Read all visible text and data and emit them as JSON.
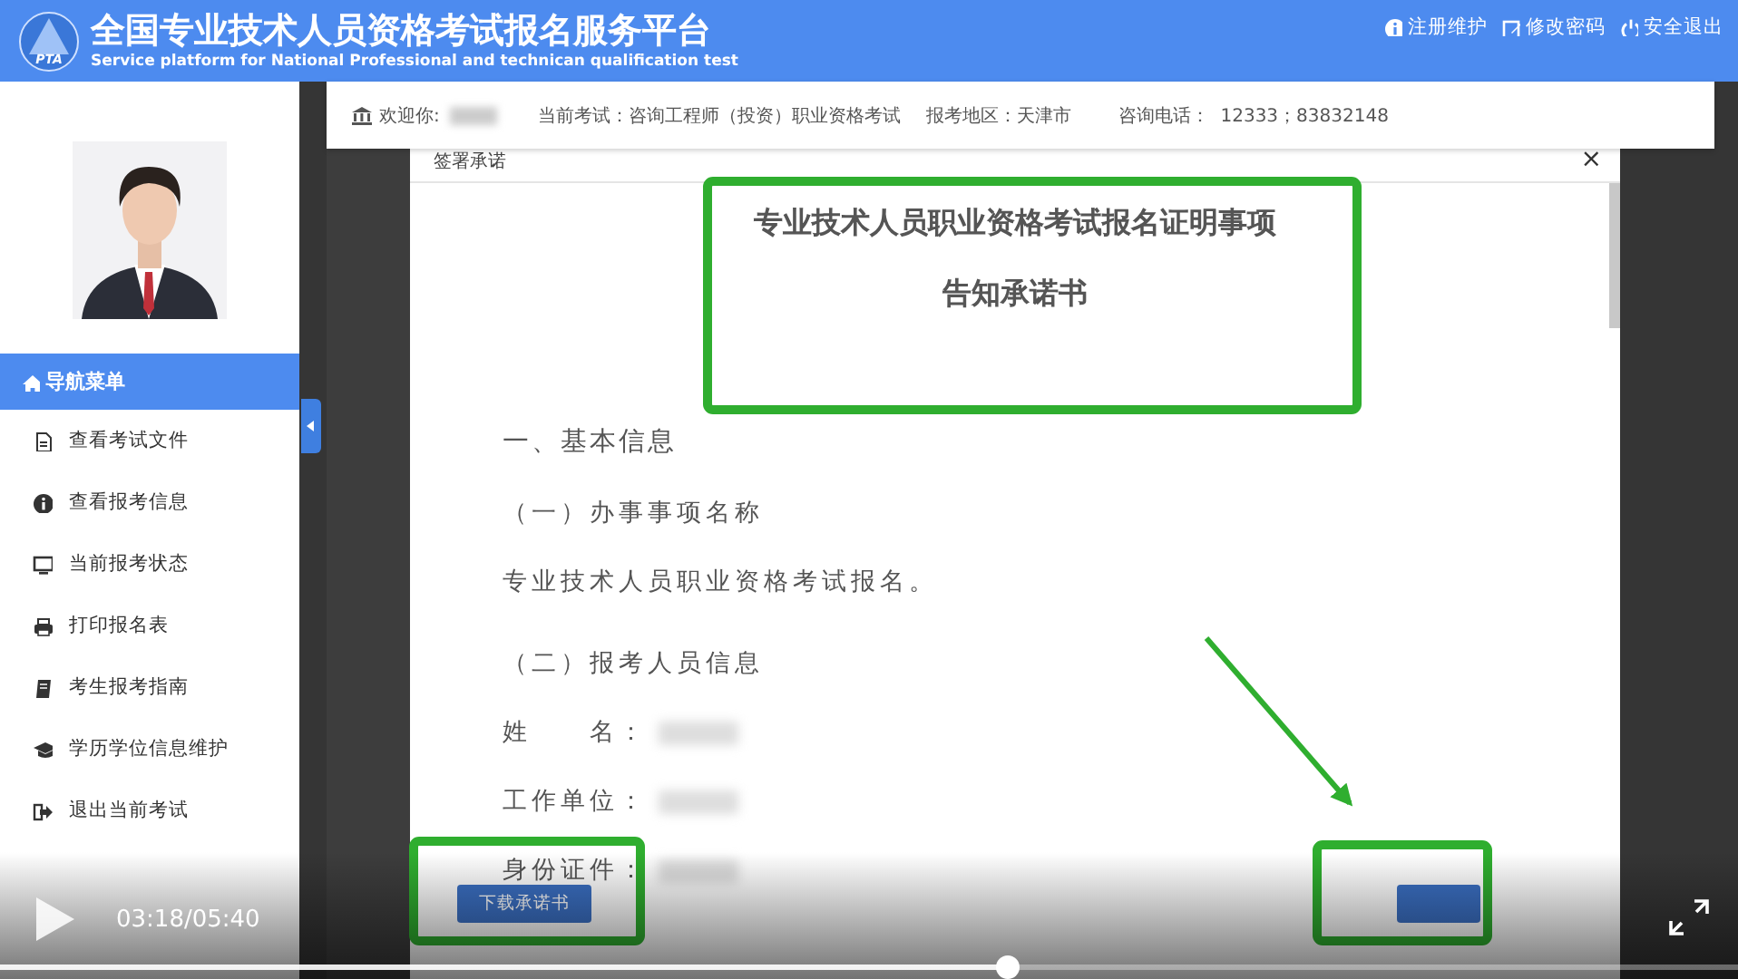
{
  "header": {
    "logo_text": "PTA",
    "title": "全国专业技术人员资格考试报名服务平台",
    "subtitle": "Service platform for National Professional and technican qualification test",
    "links": [
      {
        "label": "注册维护"
      },
      {
        "label": "修改密码"
      },
      {
        "label": "安全退出"
      }
    ]
  },
  "info_bar": {
    "welcome": "欢迎你:",
    "exam": "当前考试：咨询工程师（投资）职业资格考试",
    "region": "报考地区：天津市",
    "phone": "咨询电话：  12333；83832148"
  },
  "sidebar": {
    "menu_title": "导航菜单",
    "items": [
      {
        "label": "查看考试文件"
      },
      {
        "label": "查看报考信息"
      },
      {
        "label": "当前报考状态"
      },
      {
        "label": "打印报名表"
      },
      {
        "label": "考生报考指南"
      },
      {
        "label": "学历学位信息维护"
      },
      {
        "label": "退出当前考试"
      }
    ]
  },
  "modal": {
    "title": "签署承诺",
    "close": "×",
    "doc_title": [
      "专业技术人员职业资格考试报名证明事项",
      "告知承诺书"
    ],
    "paragraphs": [
      {
        "kind": "heading",
        "text": "一、基本信息"
      },
      {
        "kind": "subheading",
        "text": "（一）办事事项名称"
      },
      {
        "kind": "text",
        "text": "专业技术人员职业资格考试报名。"
      },
      {
        "kind": "subheading",
        "text": "（二）报考人员信息"
      },
      {
        "kind": "field",
        "text": "姓　　名："
      },
      {
        "kind": "field",
        "text": "工作单位："
      },
      {
        "kind": "field",
        "text": "身份证件："
      }
    ],
    "buttons": [
      {
        "kind": "labeled",
        "label": "下载承诺书"
      },
      {
        "kind": "covered"
      }
    ]
  },
  "annotations": [
    {
      "kind": "title-box"
    },
    {
      "kind": "download-box"
    },
    {
      "kind": "confirm-box"
    },
    {
      "kind": "arrow"
    }
  ],
  "player": {
    "time": "03:18/05:40",
    "level": 0.58
  }
}
